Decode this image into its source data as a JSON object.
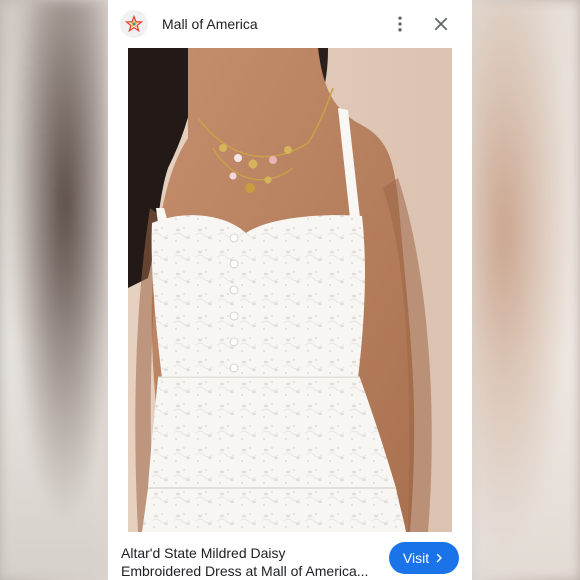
{
  "header": {
    "site_name": "Mall of America",
    "logo_icon": "mall-of-america-star-logo",
    "more_icon": "more-vert-icon",
    "close_icon": "close-icon"
  },
  "image": {
    "subject": "white-eyelet-dress-photo"
  },
  "footer": {
    "title_line1": "Altar'd State Mildred Daisy",
    "title_line2": "Embroidered Dress at Mall of America...",
    "visit_label": "Visit",
    "visit_icon": "chevron-right-icon",
    "accent": "#1a73e8"
  }
}
